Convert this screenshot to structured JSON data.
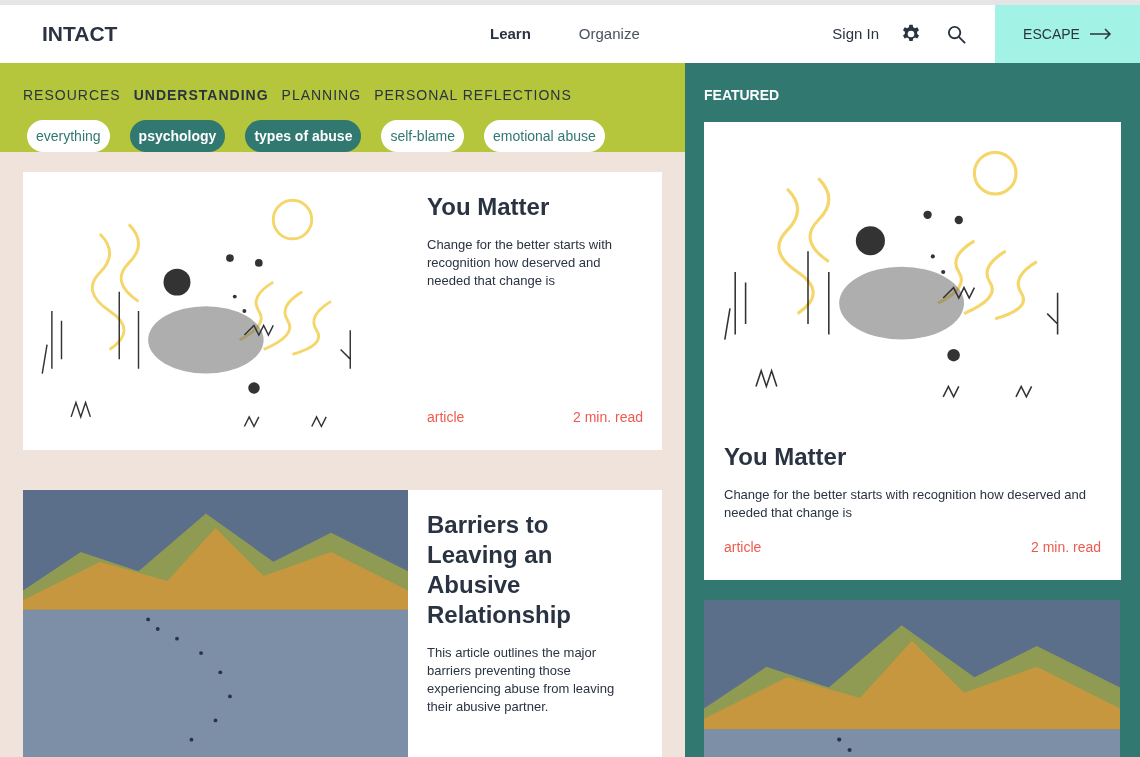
{
  "header": {
    "logo": "INTACT",
    "nav": [
      {
        "label": "Learn",
        "selected": true
      },
      {
        "label": "Organize",
        "selected": false
      }
    ],
    "sign_in": "Sign In",
    "escape": "ESCAPE"
  },
  "categories": [
    {
      "label": "RESOURCES",
      "selected": false
    },
    {
      "label": "UNDERSTANDING",
      "selected": true
    },
    {
      "label": "PLANNING",
      "selected": false
    },
    {
      "label": "PERSONAL REFLECTIONS",
      "selected": false
    }
  ],
  "tags": [
    {
      "label": "everything",
      "selected": false
    },
    {
      "label": "psychology",
      "selected": true
    },
    {
      "label": "types of abuse",
      "selected": true
    },
    {
      "label": "self-blame",
      "selected": false
    },
    {
      "label": "emotional abuse",
      "selected": false
    }
  ],
  "articles": [
    {
      "kind": "sun",
      "title": "You Matter",
      "description": "Change for the better starts with recognition how deserved and needed that change is",
      "type": "article",
      "read_time": "2 min. read"
    },
    {
      "kind": "mountains",
      "title": "Barriers to Leaving an Abusive Relationship",
      "description": "This article outlines the major barriers preventing those experiencing abuse from leaving their abusive partner."
    }
  ],
  "featured": {
    "heading": "FEATURED",
    "items": [
      {
        "kind": "sun",
        "title": "You Matter",
        "description": "Change for the better starts with recognition how deserved and needed that change is",
        "type": "article",
        "read_time": "2 min. read"
      },
      {
        "kind": "mountains"
      }
    ]
  }
}
